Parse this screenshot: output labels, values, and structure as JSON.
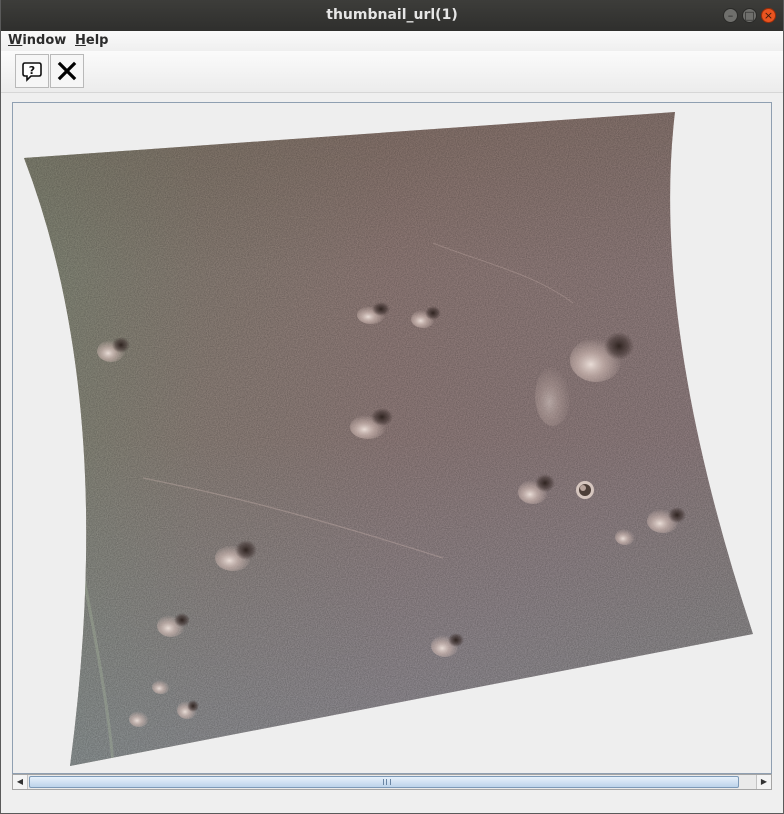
{
  "window": {
    "title": "thumbnail_url(1)",
    "controls": {
      "minimize_icon": "minimize-icon",
      "maximize_icon": "maximize-icon",
      "close_icon": "close-icon"
    }
  },
  "menubar": {
    "items": [
      {
        "mnemonic": "W",
        "rest": "indow"
      },
      {
        "mnemonic": "H",
        "rest": "elp"
      }
    ]
  },
  "toolbar": {
    "buttons": [
      {
        "icon": "help-icon"
      },
      {
        "icon": "close-icon"
      }
    ]
  },
  "image": {
    "content": "surface-photograph",
    "colors": {
      "base": "#9d8784",
      "highlight": "#c8b6b3",
      "shadow": "#4a3b37",
      "greenish": "#8b9a84",
      "bluish": "#9aa7b3"
    }
  },
  "scrollbar": {
    "position": 0.5,
    "left_icon": "arrow-left-icon",
    "right_icon": "arrow-right-icon"
  }
}
